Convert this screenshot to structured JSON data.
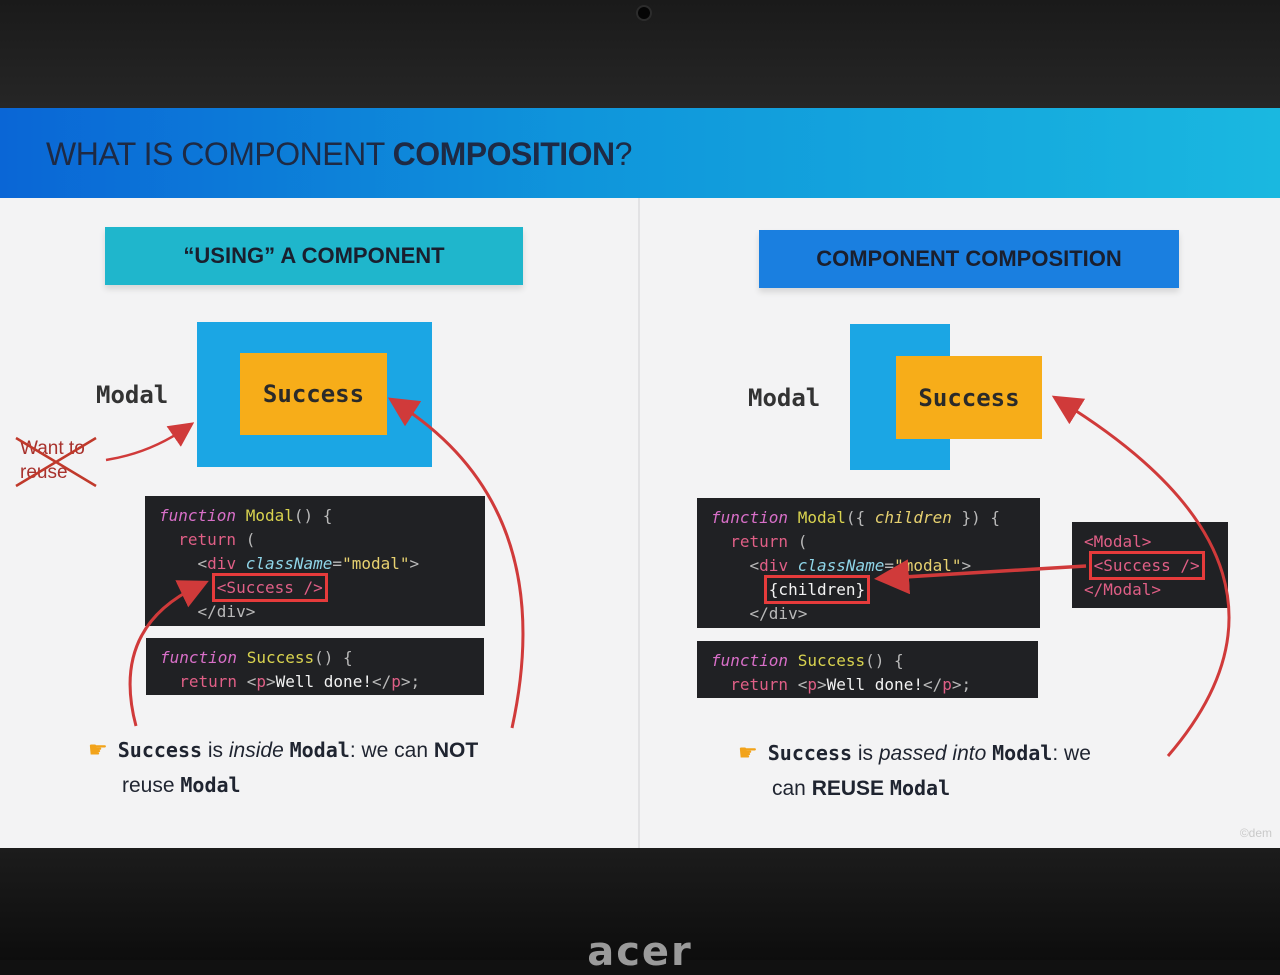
{
  "slide": {
    "title_prefix": "WHAT IS COMPONENT ",
    "title_bold": "COMPOSITION",
    "title_suffix": "?"
  },
  "left": {
    "label": "“USING” A COMPONENT",
    "modal_word": "Modal",
    "success_word": "Success",
    "crossed_note": "Want to reuse",
    "code_modal": {
      "kw": "function",
      "fn": "Modal",
      "sig": "() {",
      "ret": "return",
      "paren": " (",
      "div_open_tag": "div",
      "attr": "className",
      "val": "\"modal\"",
      "success_tag": "<Success />",
      "div_close": "</div>"
    },
    "code_success": {
      "kw": "function",
      "fn": "Success",
      "sig": "() {",
      "ret": "return",
      "p_open": "p",
      "text": "Well done!",
      "p_close": "p"
    },
    "note": {
      "a": "Success",
      "b": " is ",
      "c": "inside",
      "d": "Modal",
      "e": ": we can ",
      "f": "NOT",
      "g": "reuse ",
      "h": "Modal"
    }
  },
  "right": {
    "label": "COMPONENT COMPOSITION",
    "modal_word": "Modal",
    "success_word": "Success",
    "code_modal": {
      "kw": "function",
      "fn": "Modal",
      "sig_a": "({ ",
      "children_param": "children",
      "sig_b": " }) {",
      "ret": "return",
      "paren": " (",
      "div_open_tag": "div",
      "attr": "className",
      "val": "\"modal\"",
      "children_expr": "{children}",
      "div_close": "</div>"
    },
    "code_success": {
      "kw": "function",
      "fn": "Success",
      "sig": "() {",
      "ret": "return",
      "p_open": "p",
      "text": "Well done!",
      "p_close": "p"
    },
    "usage": {
      "open": "<Modal>",
      "inner": "<Success />",
      "close": "</Modal>"
    },
    "note": {
      "a": "Success",
      "b": " is ",
      "c": "passed into",
      "d": "Modal",
      "e": ": we",
      "f": "can ",
      "g": "REUSE",
      "h": "Modal"
    }
  },
  "watermark": "©dem",
  "laptop_brand": "acer",
  "colors": {
    "header_blue": "#0a66d6",
    "teal_label": "#1fb6cc",
    "blue_label": "#1a7fe0",
    "modal_blue": "#1ba6e4",
    "success_orange": "#f7ad19",
    "arrow_red": "#d03a3a"
  },
  "icons": [
    "pointing-hand-icon"
  ]
}
